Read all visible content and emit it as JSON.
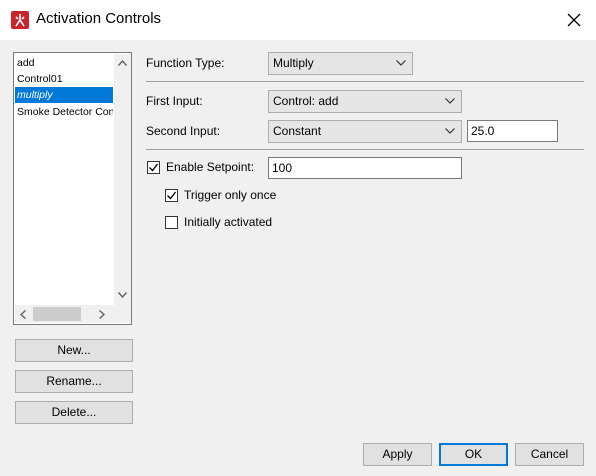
{
  "window": {
    "title": "Activation Controls"
  },
  "list": {
    "items": [
      {
        "label": "add",
        "selected": false
      },
      {
        "label": "Control01",
        "selected": false
      },
      {
        "label": "multiply",
        "selected": true
      },
      {
        "label": "Smoke Detector Control"
      }
    ]
  },
  "left_buttons": {
    "new": "New...",
    "rename": "Rename...",
    "delete": "Delete..."
  },
  "form": {
    "function_type_label": "Function Type:",
    "function_type_value": "Multiply",
    "first_input_label": "First Input:",
    "first_input_value": "Control: add",
    "second_input_label": "Second Input:",
    "second_input_value": "Constant",
    "second_input_constant": "25.0",
    "enable_setpoint_label": "Enable Setpoint:",
    "enable_setpoint_checked": true,
    "setpoint_value": "100",
    "trigger_once_label": "Trigger only once",
    "trigger_once_checked": true,
    "initially_activated_label": "Initially activated",
    "initially_activated_checked": false
  },
  "footer": {
    "apply": "Apply",
    "ok": "OK",
    "cancel": "Cancel"
  },
  "colors": {
    "selection": "#0078d7",
    "app_icon": "#c8242a"
  }
}
